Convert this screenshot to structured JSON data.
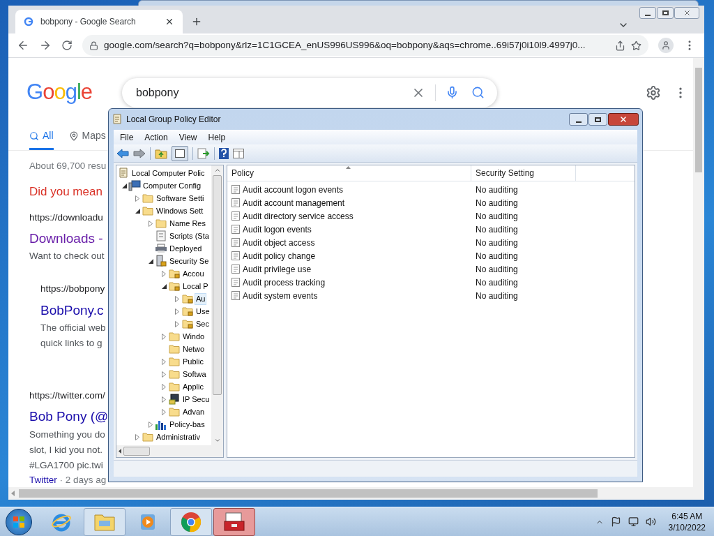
{
  "browser": {
    "tab": {
      "title": "bobpony - Google Search",
      "selected": true
    },
    "url": "google.com/search?q=bobpony&rlz=1C1GCEA_enUS996US996&oq=bobpony&aqs=chrome..69i57j0i10l9.4997j0...",
    "page": {
      "logo": "Google",
      "search": {
        "value": "bobpony"
      },
      "tabs": [
        {
          "label": "All",
          "selected": true,
          "kind": "search"
        },
        {
          "label": "Maps",
          "selected": false,
          "kind": "map"
        }
      ],
      "stats": "About 69,700 resu",
      "suggestion": "Did you mean",
      "results": [
        {
          "url": "https://downloadu",
          "title": "Downloads -",
          "snippet": [
            "Want to check out"
          ],
          "indent": false,
          "visited": true
        },
        {
          "url": "https://bobpony",
          "title": "BobPony.c",
          "snippet": [
            "The official web",
            "quick links to g"
          ],
          "indent": true,
          "visited": false
        },
        {
          "url": "https://twitter.com/",
          "title": "Bob Pony (@",
          "snippet": [
            "Something you do",
            "slot, I kid you not.",
            "#LGA1700 pic.twi"
          ],
          "indent": false,
          "visited": false,
          "source": "Twitter",
          "age": "· 2 days ag"
        }
      ]
    }
  },
  "gpe": {
    "title": "Local Group Policy Editor",
    "menu": [
      "File",
      "Action",
      "View",
      "Help"
    ],
    "tree": [
      {
        "label": "Local Computer Polic",
        "kind": "policy",
        "selected": false,
        "children": [
          {
            "label": "Computer Config",
            "kind": "computer",
            "expanded": true,
            "selected": false,
            "children": [
              {
                "label": "Software Setti",
                "kind": "folder",
                "expanded": false,
                "selected": false
              },
              {
                "label": "Windows Sett",
                "kind": "folder",
                "expanded": true,
                "selected": false,
                "children": [
                  {
                    "label": "Name Res",
                    "kind": "folder",
                    "expanded": false,
                    "selected": false
                  },
                  {
                    "label": "Scripts (Sta",
                    "kind": "script",
                    "selected": false
                  },
                  {
                    "label": "Deployed",
                    "kind": "printer",
                    "selected": false
                  },
                  {
                    "label": "Security Se",
                    "kind": "security",
                    "expanded": true,
                    "selected": false,
                    "children": [
                      {
                        "label": "Accou",
                        "kind": "lockfolder",
                        "expanded": false,
                        "selected": false
                      },
                      {
                        "label": "Local P",
                        "kind": "lockfolder",
                        "expanded": true,
                        "selected": false,
                        "children": [
                          {
                            "label": "Au",
                            "kind": "lockfolder",
                            "expanded": false,
                            "selected": true
                          },
                          {
                            "label": "Use",
                            "kind": "lockfolder",
                            "expanded": false,
                            "selected": false
                          },
                          {
                            "label": "Sec",
                            "kind": "lockfolder",
                            "expanded": false,
                            "selected": false
                          }
                        ]
                      },
                      {
                        "label": "Windo",
                        "kind": "folder",
                        "expanded": false,
                        "selected": false
                      },
                      {
                        "label": "Netwo",
                        "kind": "folder",
                        "selected": false
                      },
                      {
                        "label": "Public",
                        "kind": "folder",
                        "expanded": false,
                        "selected": false
                      },
                      {
                        "label": "Softwa",
                        "kind": "folder",
                        "expanded": false,
                        "selected": false
                      },
                      {
                        "label": "Applic",
                        "kind": "folder",
                        "expanded": false,
                        "selected": false
                      },
                      {
                        "label": "IP Secu",
                        "kind": "network",
                        "expanded": false,
                        "selected": false
                      },
                      {
                        "label": "Advan",
                        "kind": "folder",
                        "expanded": false,
                        "selected": false
                      }
                    ]
                  },
                  {
                    "label": "Policy-bas",
                    "kind": "chart",
                    "expanded": false,
                    "selected": false
                  }
                ]
              },
              {
                "label": "Administrativ",
                "kind": "folder",
                "expanded": false,
                "selected": false
              }
            ]
          }
        ]
      }
    ],
    "columns": [
      "Policy",
      "Security Setting"
    ],
    "rows": [
      {
        "policy": "Audit account logon events",
        "setting": "No auditing"
      },
      {
        "policy": "Audit account management",
        "setting": "No auditing"
      },
      {
        "policy": "Audit directory service access",
        "setting": "No auditing"
      },
      {
        "policy": "Audit logon events",
        "setting": "No auditing"
      },
      {
        "policy": "Audit object access",
        "setting": "No auditing"
      },
      {
        "policy": "Audit policy change",
        "setting": "No auditing"
      },
      {
        "policy": "Audit privilege use",
        "setting": "No auditing"
      },
      {
        "policy": "Audit process tracking",
        "setting": "No auditing"
      },
      {
        "policy": "Audit system events",
        "setting": "No auditing"
      }
    ]
  },
  "taskbar": {
    "apps": [
      {
        "kind": "ie",
        "selected": false
      },
      {
        "kind": "explorer",
        "selected": false
      },
      {
        "kind": "media",
        "selected": false
      },
      {
        "kind": "chrome",
        "selected": false
      },
      {
        "kind": "gpe",
        "selected": true
      }
    ],
    "time": "6:45 AM",
    "date": "3/10/2022"
  }
}
